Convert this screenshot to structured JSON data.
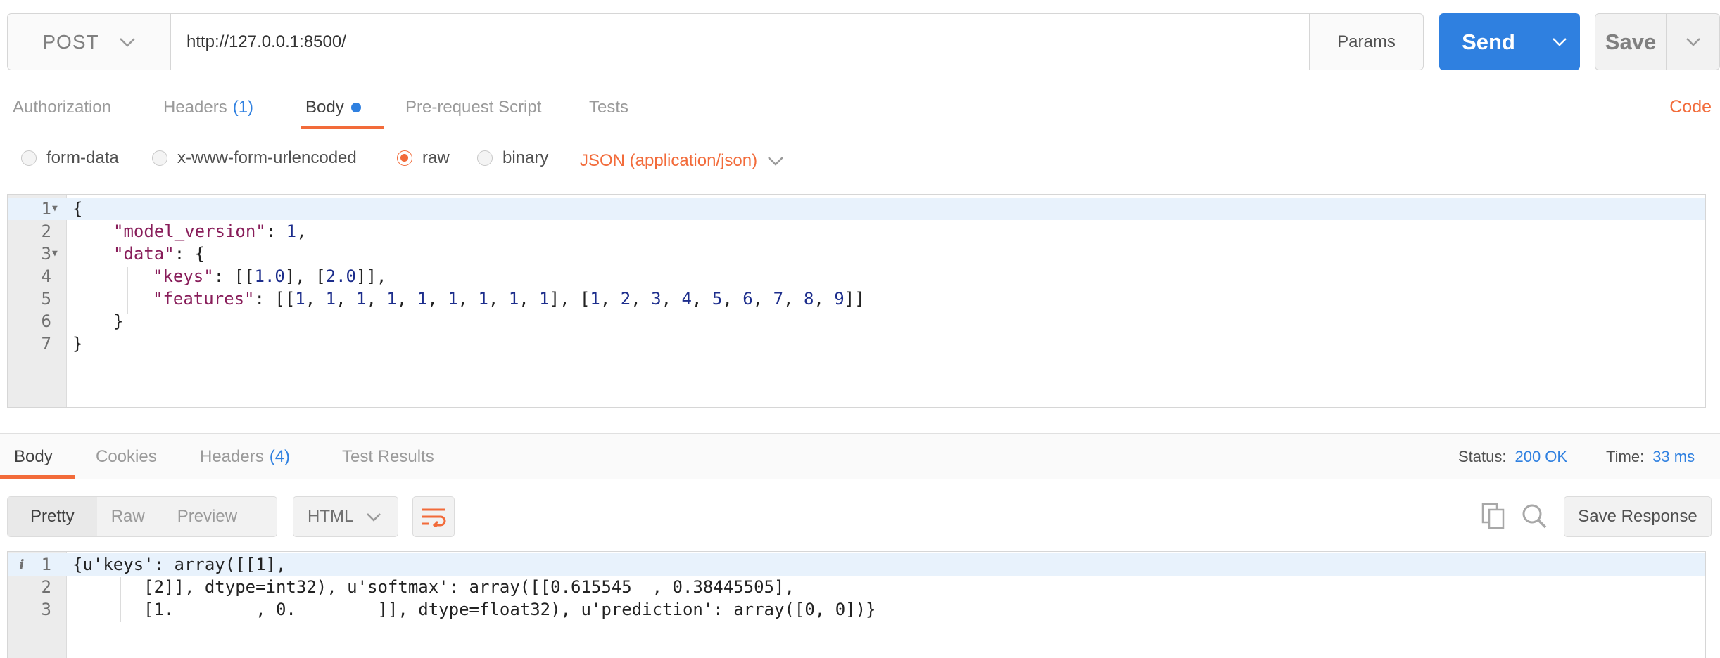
{
  "request": {
    "method": "POST",
    "url": "http://127.0.0.1:8500/",
    "params_label": "Params",
    "send_label": "Send",
    "save_label": "Save"
  },
  "request_tabs": {
    "authorization": "Authorization",
    "headers": "Headers",
    "headers_count": "(1)",
    "body": "Body",
    "prerequest": "Pre-request Script",
    "tests": "Tests",
    "code": "Code"
  },
  "body_options": {
    "form_data": "form-data",
    "urlencoded": "x-www-form-urlencoded",
    "raw": "raw",
    "binary": "binary",
    "selected": "raw",
    "content_type": "JSON (application/json)"
  },
  "request_body": {
    "line_numbers": [
      "1",
      "2",
      "3",
      "4",
      "5",
      "6",
      "7"
    ],
    "l1": "{",
    "l2_key": "\"model_version\"",
    "l2_sep": ": ",
    "l2_val": "1",
    "l2_end": ",",
    "l3_key": "\"data\"",
    "l3_rest": ": {",
    "l4_key": "\"keys\"",
    "l4_a": ": [[",
    "l4_v1": "1.0",
    "l4_b": "], [",
    "l4_v2": "2.0",
    "l4_c": "]],",
    "l5_key": "\"features\"",
    "l5_a": ": [[",
    "l5_row1": [
      "1",
      "1",
      "1",
      "1",
      "1",
      "1",
      "1",
      "1",
      "1"
    ],
    "l5_mid": "], [",
    "l5_row2": [
      "1",
      "2",
      "3",
      "4",
      "5",
      "6",
      "7",
      "8",
      "9"
    ],
    "l5_end": "]]",
    "l6": "}",
    "l7": "}"
  },
  "response_tabs": {
    "body": "Body",
    "cookies": "Cookies",
    "headers": "Headers",
    "headers_count": "(4)",
    "test_results": "Test Results",
    "status_label": "Status:",
    "status_value": "200 OK",
    "time_label": "Time:",
    "time_value": "33 ms"
  },
  "response_view": {
    "pretty": "Pretty",
    "raw": "Raw",
    "preview": "Preview",
    "format": "HTML",
    "save_response": "Save Response"
  },
  "response_body": {
    "line_numbers": [
      "1",
      "2",
      "3"
    ],
    "l1": "{u'keys': array([[1],",
    "l2": "       [2]], dtype=int32), u'softmax': array([[0.615545  , 0.38445505],",
    "l3": "       [1.        , 0.        ]], dtype=float32), u'prediction': array([0, 0])}"
  },
  "colors": {
    "accent_orange": "#f26b3a",
    "accent_blue": "#2f80e0"
  },
  "icons": {
    "method_caret": "chevron-down-icon",
    "send_caret": "chevron-down-icon",
    "save_caret": "chevron-down-icon",
    "wrap": "wrap-lines-icon",
    "copy": "copy-icon",
    "search": "search-icon",
    "info": "info-icon"
  }
}
